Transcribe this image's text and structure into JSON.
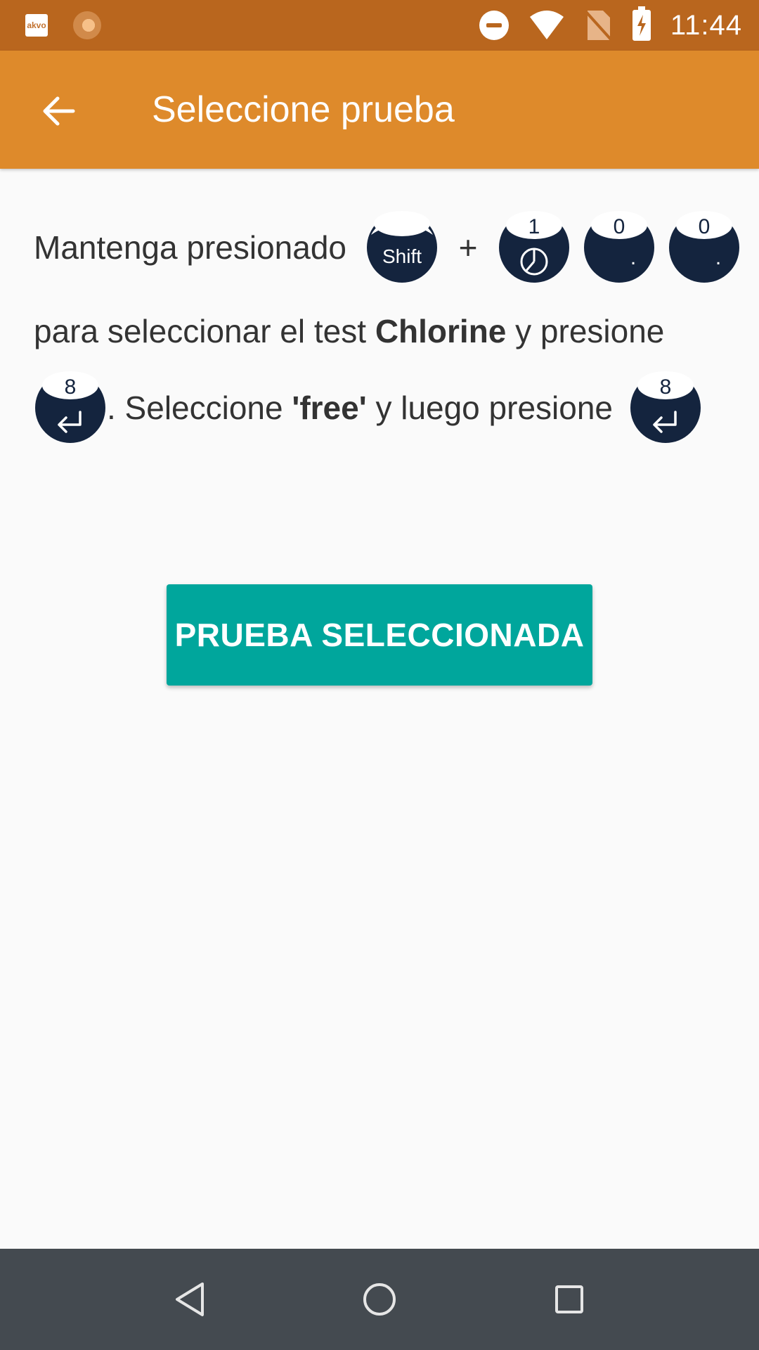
{
  "status_bar": {
    "app_badge": "akvo",
    "time": "11:44"
  },
  "app_bar": {
    "title": "Seleccione prueba"
  },
  "instructions": {
    "line1_text": "Mantenga presionado",
    "plus": "+",
    "line2_pre": "para seleccionar el test",
    "line2_bold": "Chlorine",
    "line2_post": "y presione",
    "line3_pre": ". Seleccione",
    "line3_bold": "'free'",
    "line3_post": "y luego presione",
    "keys": {
      "shift": "Shift",
      "one": "1",
      "zero": "0",
      "dot": ".",
      "eight": "8"
    }
  },
  "action": {
    "label": "PRUEBA SELECCIONADA"
  },
  "colors": {
    "status_bar": "#b9661e",
    "app_bar": "#de8a2b",
    "key_fill": "#14243e",
    "button": "#00a69c",
    "nav_bar": "#444a50"
  }
}
